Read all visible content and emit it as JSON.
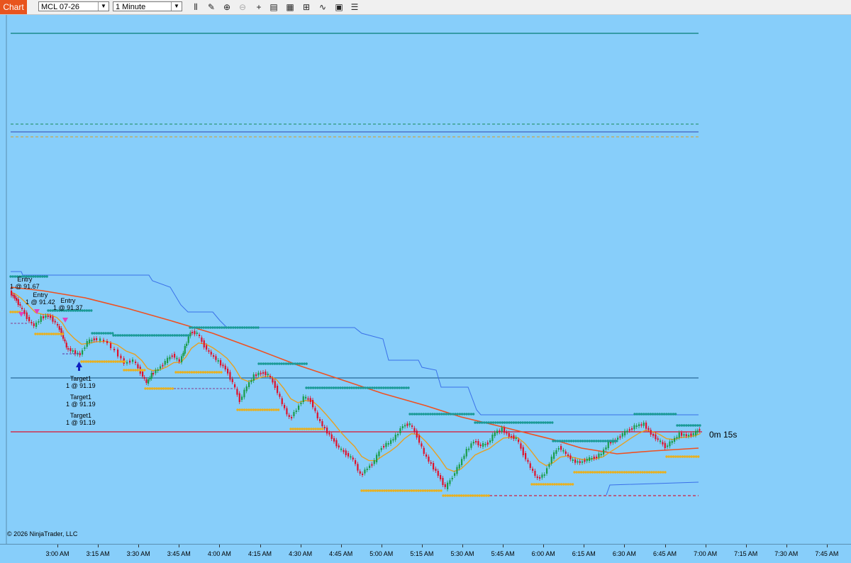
{
  "toolbar": {
    "tab_label": "Chart",
    "instrument": "MCL 07-26",
    "interval": "1 Minute",
    "buttons": [
      {
        "name": "bars-icon",
        "glyph": "⫴"
      },
      {
        "name": "pencil-icon",
        "glyph": "✎"
      },
      {
        "name": "zoom-in-icon",
        "glyph": "⊕"
      },
      {
        "name": "zoom-out-icon",
        "glyph": "⊖"
      },
      {
        "name": "crosshair-icon",
        "glyph": "+"
      },
      {
        "name": "properties-icon",
        "glyph": "▤"
      },
      {
        "name": "data-box-icon",
        "glyph": "▦"
      },
      {
        "name": "indicators-icon",
        "glyph": "⊞"
      },
      {
        "name": "strategies-icon",
        "glyph": "∿"
      },
      {
        "name": "templates-icon",
        "glyph": "▣"
      },
      {
        "name": "menu-icon",
        "glyph": "☰"
      }
    ]
  },
  "chart": {
    "background": "#87cefa",
    "copyright": "© 2026 NinjaTrader, LLC",
    "bar_timer": "0m 15s",
    "colors": {
      "up": "#1a9c4a",
      "down": "#e0102a",
      "ema_fast": "#e8a020",
      "ema_slow": "#f05020",
      "channel": "#3a70e8",
      "resistance": "#1a9a96",
      "support": "#e8b020",
      "price_line": "#e0102a"
    },
    "time_axis": [
      "3:00 AM",
      "3:15 AM",
      "3:30 AM",
      "3:45 AM",
      "4:00 AM",
      "4:15 AM",
      "4:30 AM",
      "4:45 AM",
      "5:00 AM",
      "5:15 AM",
      "5:30 AM",
      "5:45 AM",
      "6:00 AM",
      "6:15 AM",
      "6:30 AM",
      "6:45 AM",
      "7:00 AM",
      "7:15 AM",
      "7:30 AM",
      "7:45 AM"
    ],
    "executions": [
      {
        "line1": "Entry",
        "line2": "1 @ 91.67"
      },
      {
        "line1": "Entry",
        "line2": "1 @ 91.42"
      },
      {
        "line1": "Entry",
        "line2": "1 @ 91.37"
      },
      {
        "line1": "Target1",
        "line2": "1 @ 91.19"
      },
      {
        "line1": "Target1",
        "line2": "1 @ 91.19"
      },
      {
        "line1": "Target1",
        "line2": "1 @ 91.19"
      }
    ]
  }
}
